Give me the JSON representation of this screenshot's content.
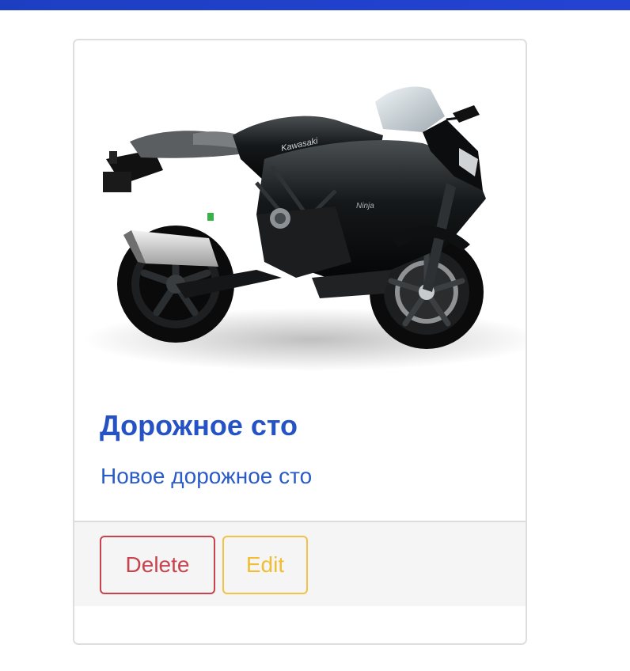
{
  "card": {
    "image": {
      "alt": "Kawasaki Ninja motorcycle",
      "brand_mark": "Kawasaki",
      "model_mark": "Ninja"
    },
    "title": "Дорожное сто",
    "text": "Новое дорожное сто",
    "buttons": {
      "delete_label": "Delete",
      "edit_label": "Edit"
    }
  },
  "colors": {
    "topbar": "#1c3fc2",
    "title": "#2553c5",
    "delete": "#c9434e",
    "edit": "#f0bd33",
    "footer_bg": "#f5f5f5"
  }
}
